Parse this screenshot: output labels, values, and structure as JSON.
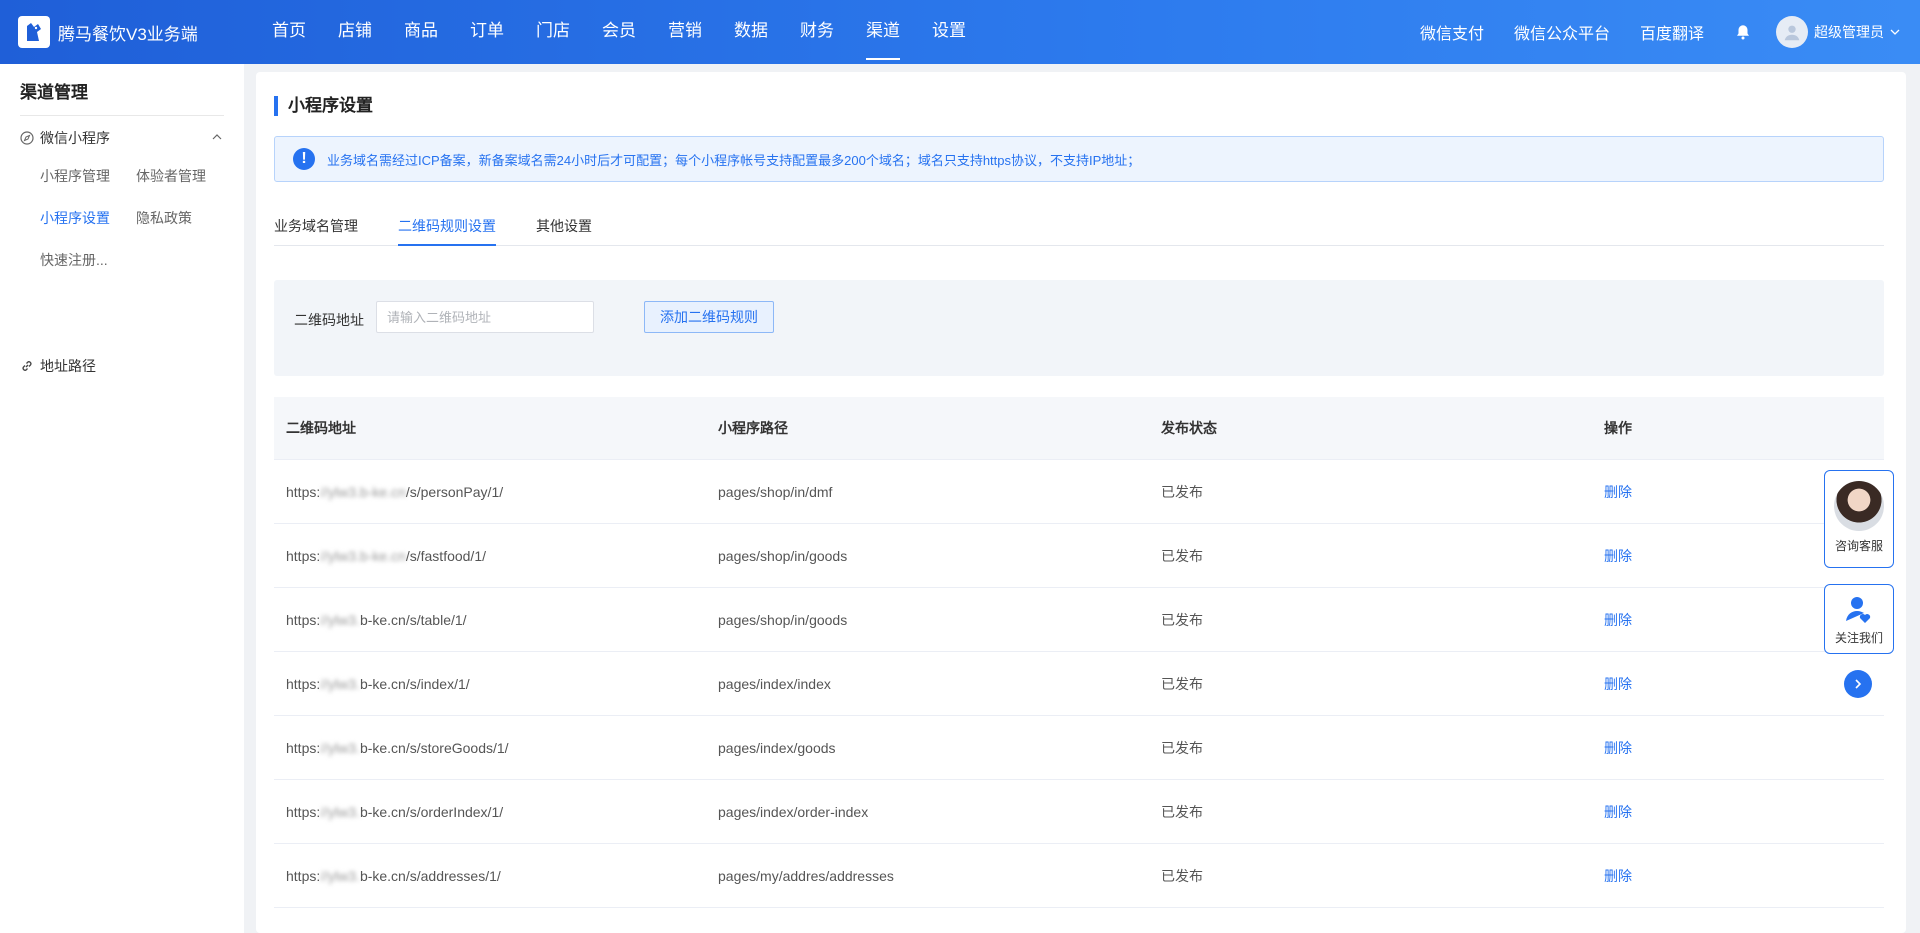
{
  "brand": {
    "title": "腾马餐饮V3业务端"
  },
  "topnav": [
    "首页",
    "店铺",
    "商品",
    "订单",
    "门店",
    "会员",
    "营销",
    "数据",
    "财务",
    "渠道",
    "设置"
  ],
  "topnav_active": "渠道",
  "topright": {
    "links": [
      "微信支付",
      "微信公众平台",
      "百度翻译"
    ],
    "user_name": "超级管理员"
  },
  "sidebar": {
    "title": "渠道管理",
    "group1": "微信小程序",
    "sub": [
      "小程序管理",
      "体验者管理",
      "小程序设置",
      "隐私政策",
      "快速注册..."
    ],
    "group2": "地址路径"
  },
  "main": {
    "title": "小程序设置",
    "alert": "业务域名需经过ICP备案，新备案域名需24小时后才可配置；每个小程序帐号支持配置最多200个域名；域名只支持https协议，不支持IP地址；",
    "tabs": [
      "业务域名管理",
      "二维码规则设置",
      "其他设置"
    ],
    "filter": {
      "label": "二维码地址",
      "placeholder": "请输入二维码地址",
      "add_button": "添加二维码规则"
    },
    "table": {
      "headers": [
        "二维码地址",
        "小程序路径",
        "发布状态",
        "操作"
      ],
      "rows": [
        {
          "prefix": "https:",
          "masked": "//ylw3.b-ke.cn",
          "suffix": "/s/personPay/1/",
          "path": "pages/shop/in/dmf",
          "status": "已发布",
          "action": "删除"
        },
        {
          "prefix": "https:",
          "masked": "//ylw3.b-ke.cn",
          "suffix": "/s/fastfood/1/",
          "path": "pages/shop/in/goods",
          "status": "已发布",
          "action": "删除"
        },
        {
          "prefix": "https:",
          "masked": "//ylw3.",
          "suffix": "b-ke.cn/s/table/1/",
          "path": "pages/shop/in/goods",
          "status": "已发布",
          "action": "删除"
        },
        {
          "prefix": "https:",
          "masked": "//ylw3.",
          "suffix": "b-ke.cn/s/index/1/",
          "path": "pages/index/index",
          "status": "已发布",
          "action": "删除"
        },
        {
          "prefix": "https:",
          "masked": "//ylw3.",
          "suffix": "b-ke.cn/s/storeGoods/1/",
          "path": "pages/index/goods",
          "status": "已发布",
          "action": "删除"
        },
        {
          "prefix": "https:",
          "masked": "//ylw3.",
          "suffix": "b-ke.cn/s/orderIndex/1/",
          "path": "pages/index/order-index",
          "status": "已发布",
          "action": "删除"
        },
        {
          "prefix": "https:",
          "masked": "//ylw3.",
          "suffix": "b-ke.cn/s/addresses/1/",
          "path": "pages/my/addres/addresses",
          "status": "已发布",
          "action": "删除"
        }
      ]
    }
  },
  "float": {
    "cs_label": "咨询客服",
    "follow_label": "关注我们"
  },
  "colors": {
    "accent": "#2672f0",
    "topbar": "#2d7bee"
  }
}
